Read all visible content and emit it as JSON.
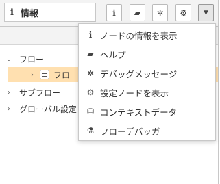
{
  "header": {
    "title_icon": "i",
    "title": "情報",
    "toolbar": [
      {
        "icon": "info-icon",
        "glyph": "i"
      },
      {
        "icon": "book-icon",
        "glyph": "▰"
      },
      {
        "icon": "bug-icon",
        "glyph": "✲"
      },
      {
        "icon": "gear-icon",
        "glyph": "⚙"
      },
      {
        "icon": "caret-down-icon",
        "glyph": "▼"
      }
    ]
  },
  "tree": {
    "items": [
      {
        "label": "フロー",
        "expanded": true
      },
      {
        "label": "フロ",
        "selected": true
      },
      {
        "label": "サブフロー",
        "expanded": false
      },
      {
        "label": "グローバル設定",
        "expanded": false
      }
    ]
  },
  "menu": {
    "items": [
      {
        "icon": "info-icon",
        "glyph": "i",
        "label": "ノードの情報を表示"
      },
      {
        "icon": "book-icon",
        "glyph": "▰",
        "label": "ヘルプ"
      },
      {
        "icon": "bug-icon",
        "glyph": "✲",
        "label": "デバッグメッセージ"
      },
      {
        "icon": "gear-icon",
        "glyph": "⚙",
        "label": "設定ノードを表示"
      },
      {
        "icon": "database-icon",
        "glyph": "⛁",
        "label": "コンテキストデータ"
      },
      {
        "icon": "flask-icon",
        "glyph": "⚗",
        "label": "フローデバッガ"
      }
    ]
  },
  "colors": {
    "selected_row": "#ffe0b0",
    "panel_bg": "#f3f3f3",
    "border": "#c8c8c8"
  }
}
